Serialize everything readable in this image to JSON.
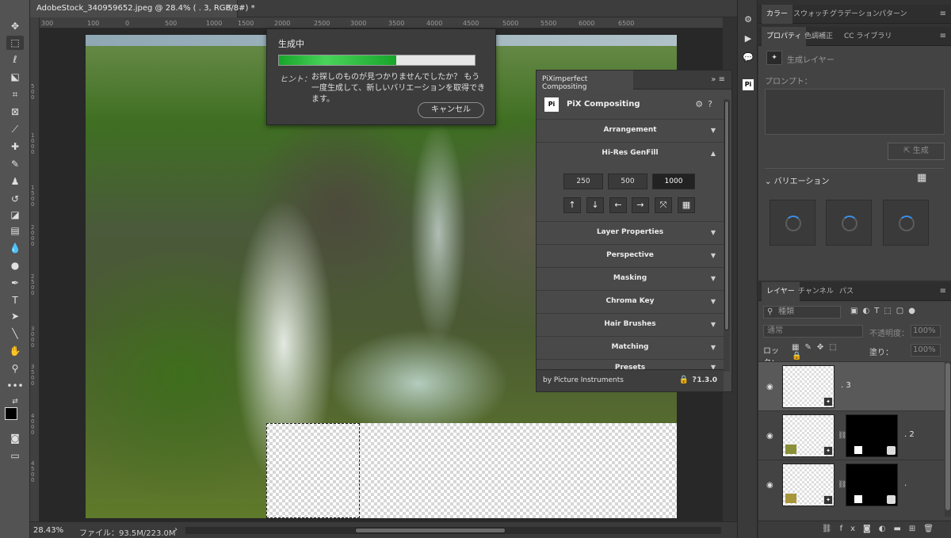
{
  "document": {
    "tab_title": "AdobeStock_340959652.jpeg @ 28.4% ( . 3, RGB/8#) *",
    "ruler_top_ticks": [
      "300",
      "100",
      "0",
      "500",
      "1000",
      "1500",
      "2000",
      "2500",
      "3000",
      "3500",
      "4000",
      "4500",
      "5000",
      "5500",
      "6000",
      "6500"
    ],
    "ruler_left_ticks": [
      "500",
      "1000",
      "1500",
      "2000",
      "2500",
      "3000",
      "3500",
      "4000",
      "4500"
    ]
  },
  "generating": {
    "title": "生成中",
    "progress": 0.6,
    "hint_label": "ヒント：",
    "hint_text": "お探しのものが見つかりませんでしたか？ もう一度生成して、新しいバリエーションを取得できます。",
    "cancel_label": "キャンセル"
  },
  "pix": {
    "tab_title": "PiXimperfect Compositing",
    "brand_name": "PiX Compositing",
    "logo_text": "Pi",
    "sections": [
      "Arrangement",
      "Hi-Res GenFill",
      "Layer Properties",
      "Perspective",
      "Masking",
      "Chroma Key",
      "Hair Brushes",
      "Matching",
      "Presets"
    ],
    "sizes": [
      "250",
      "500",
      "1000"
    ],
    "selected_size": "1000",
    "footer_by": "by Picture Instruments",
    "version": "1.3.0"
  },
  "status": {
    "zoom": "28.43%",
    "file_info": "ファイル：93.5M/223.0M"
  },
  "right": {
    "top_tabs": [
      "カラー",
      "スウォッチ",
      "グラデーション",
      "パターン"
    ],
    "props_tabs": [
      "プロパティ",
      "色調補正",
      "CC ライブラリ"
    ],
    "layer_type": "生成レイヤー",
    "prompt_label": "プロンプト：",
    "generate_label": "生成",
    "variations_label": "バリエーション",
    "layers_tabs": [
      "レイヤー",
      "チャンネル",
      "パス"
    ],
    "filter_kind": "種類",
    "blend_mode": "通常",
    "opacity_label": "不透明度：",
    "opacity_value": "100%",
    "lock_label": "ロック：",
    "fill_label": "塗り：",
    "fill_value": "100%",
    "layers": [
      {
        "name": ". 3"
      },
      {
        "name": ". 2"
      },
      {
        "name": "."
      }
    ]
  }
}
